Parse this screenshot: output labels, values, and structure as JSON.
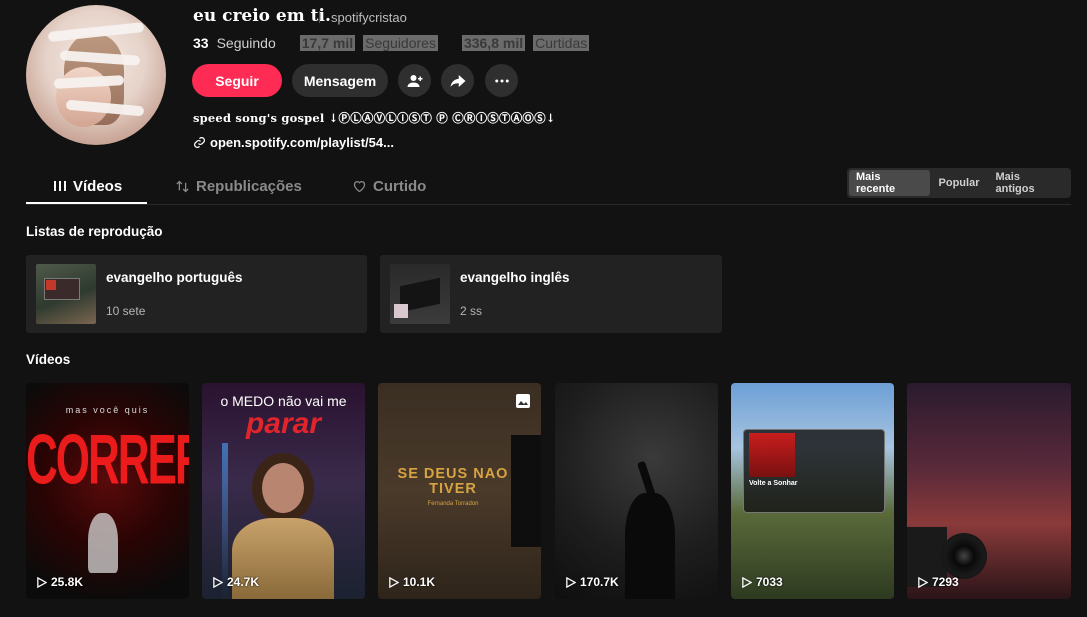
{
  "profile": {
    "display_name": "eu creio em ti.",
    "username": "spotifycristao",
    "following_count": "33",
    "following_label": "Seguindo",
    "followers_count": "17,7 mil",
    "followers_label": "Seguidores",
    "likes_count": "336,8 mil",
    "likes_label": "Curtidas",
    "bio": "speed song's gospel ↓ⓅⓁⒶⓋⓁⒾⓈⓉ Ⓟ ⒸⓇⒾⓈⓉⒶⓄⓈ↓",
    "link": "open.spotify.com/playlist/54..."
  },
  "actions": {
    "follow_label": "Seguir",
    "message_label": "Mensagem",
    "add_friend_icon": "person-add-icon",
    "share_icon": "share-icon",
    "more_icon": "more-icon"
  },
  "tabs": [
    {
      "label": "Vídeos",
      "icon": "grid-icon",
      "active": true
    },
    {
      "label": "Republicações",
      "icon": "repost-icon",
      "active": false
    },
    {
      "label": "Curtido",
      "icon": "heart-icon",
      "active": false
    }
  ],
  "sort": [
    {
      "label": "Mais recente",
      "selected": true
    },
    {
      "label": "Popular",
      "selected": false
    },
    {
      "label": "Mais antigos",
      "selected": false
    }
  ],
  "playlists_section": {
    "title": "Listas de reprodução",
    "items": [
      {
        "title": "evangelho português",
        "count": "10 sete"
      },
      {
        "title": "evangelho inglês",
        "count": "2 ss"
      }
    ]
  },
  "videos_section": {
    "title": "Vídeos",
    "items": [
      {
        "views": "25.8K",
        "overlay_top": "mas você quis",
        "overlay_main": "CORRER"
      },
      {
        "views": "24.7K",
        "overlay_top": "o MEDO não vai me",
        "overlay_main": "parar"
      },
      {
        "views": "10.1K",
        "overlay_main": "SE DEUS NAO TIVER",
        "overlay_sub": "Fernanda Torradon"
      },
      {
        "views": "170.7K"
      },
      {
        "views": "7033",
        "overlay_main": "Volte a Sonhar"
      },
      {
        "views": "7293"
      }
    ]
  },
  "colors": {
    "background": "#121212",
    "accent": "#fe2c55",
    "card": "#222222"
  }
}
